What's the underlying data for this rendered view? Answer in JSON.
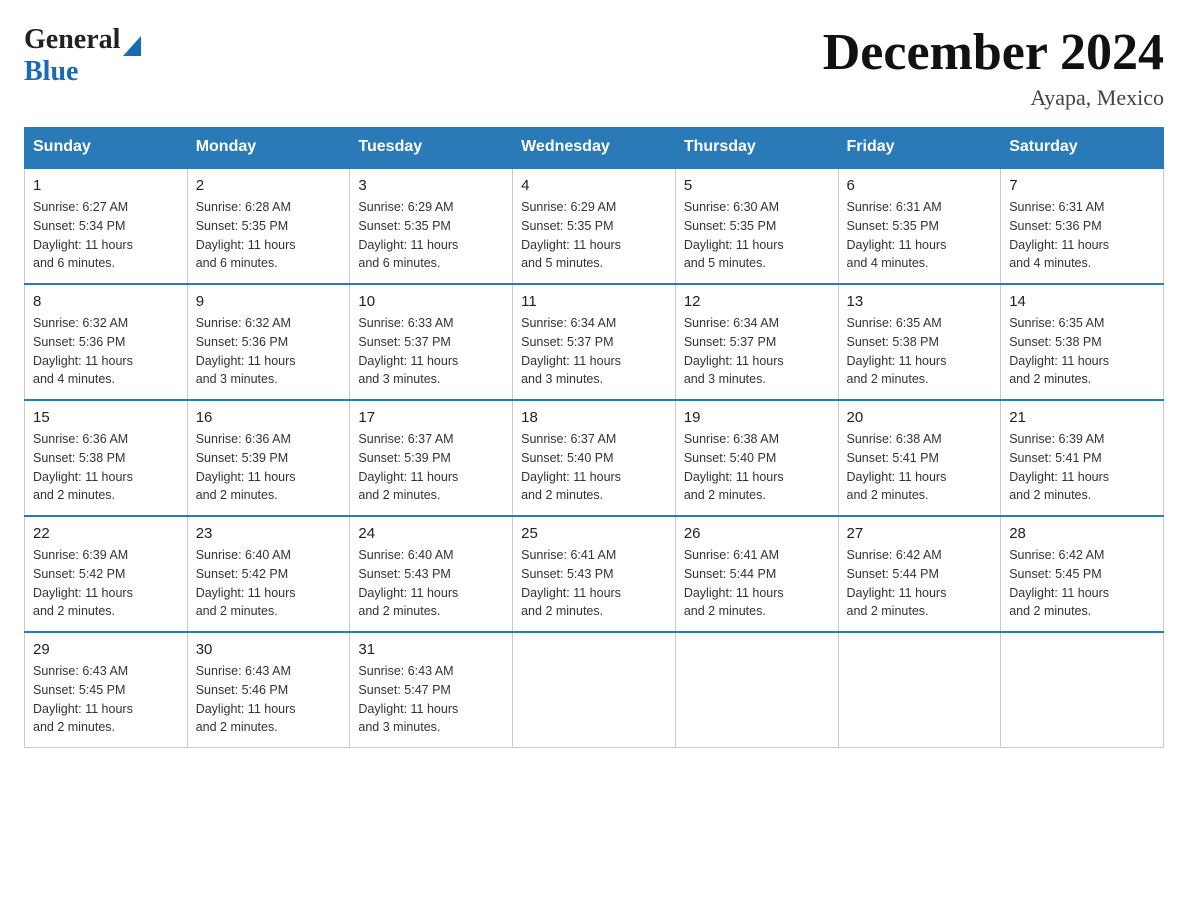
{
  "logo": {
    "text_general": "General",
    "text_blue": "Blue",
    "triangle": "▶"
  },
  "title": "December 2024",
  "subtitle": "Ayapa, Mexico",
  "headers": [
    "Sunday",
    "Monday",
    "Tuesday",
    "Wednesday",
    "Thursday",
    "Friday",
    "Saturday"
  ],
  "weeks": [
    [
      {
        "day": "1",
        "info": "Sunrise: 6:27 AM\nSunset: 5:34 PM\nDaylight: 11 hours\nand 6 minutes."
      },
      {
        "day": "2",
        "info": "Sunrise: 6:28 AM\nSunset: 5:35 PM\nDaylight: 11 hours\nand 6 minutes."
      },
      {
        "day": "3",
        "info": "Sunrise: 6:29 AM\nSunset: 5:35 PM\nDaylight: 11 hours\nand 6 minutes."
      },
      {
        "day": "4",
        "info": "Sunrise: 6:29 AM\nSunset: 5:35 PM\nDaylight: 11 hours\nand 5 minutes."
      },
      {
        "day": "5",
        "info": "Sunrise: 6:30 AM\nSunset: 5:35 PM\nDaylight: 11 hours\nand 5 minutes."
      },
      {
        "day": "6",
        "info": "Sunrise: 6:31 AM\nSunset: 5:35 PM\nDaylight: 11 hours\nand 4 minutes."
      },
      {
        "day": "7",
        "info": "Sunrise: 6:31 AM\nSunset: 5:36 PM\nDaylight: 11 hours\nand 4 minutes."
      }
    ],
    [
      {
        "day": "8",
        "info": "Sunrise: 6:32 AM\nSunset: 5:36 PM\nDaylight: 11 hours\nand 4 minutes."
      },
      {
        "day": "9",
        "info": "Sunrise: 6:32 AM\nSunset: 5:36 PM\nDaylight: 11 hours\nand 3 minutes."
      },
      {
        "day": "10",
        "info": "Sunrise: 6:33 AM\nSunset: 5:37 PM\nDaylight: 11 hours\nand 3 minutes."
      },
      {
        "day": "11",
        "info": "Sunrise: 6:34 AM\nSunset: 5:37 PM\nDaylight: 11 hours\nand 3 minutes."
      },
      {
        "day": "12",
        "info": "Sunrise: 6:34 AM\nSunset: 5:37 PM\nDaylight: 11 hours\nand 3 minutes."
      },
      {
        "day": "13",
        "info": "Sunrise: 6:35 AM\nSunset: 5:38 PM\nDaylight: 11 hours\nand 2 minutes."
      },
      {
        "day": "14",
        "info": "Sunrise: 6:35 AM\nSunset: 5:38 PM\nDaylight: 11 hours\nand 2 minutes."
      }
    ],
    [
      {
        "day": "15",
        "info": "Sunrise: 6:36 AM\nSunset: 5:38 PM\nDaylight: 11 hours\nand 2 minutes."
      },
      {
        "day": "16",
        "info": "Sunrise: 6:36 AM\nSunset: 5:39 PM\nDaylight: 11 hours\nand 2 minutes."
      },
      {
        "day": "17",
        "info": "Sunrise: 6:37 AM\nSunset: 5:39 PM\nDaylight: 11 hours\nand 2 minutes."
      },
      {
        "day": "18",
        "info": "Sunrise: 6:37 AM\nSunset: 5:40 PM\nDaylight: 11 hours\nand 2 minutes."
      },
      {
        "day": "19",
        "info": "Sunrise: 6:38 AM\nSunset: 5:40 PM\nDaylight: 11 hours\nand 2 minutes."
      },
      {
        "day": "20",
        "info": "Sunrise: 6:38 AM\nSunset: 5:41 PM\nDaylight: 11 hours\nand 2 minutes."
      },
      {
        "day": "21",
        "info": "Sunrise: 6:39 AM\nSunset: 5:41 PM\nDaylight: 11 hours\nand 2 minutes."
      }
    ],
    [
      {
        "day": "22",
        "info": "Sunrise: 6:39 AM\nSunset: 5:42 PM\nDaylight: 11 hours\nand 2 minutes."
      },
      {
        "day": "23",
        "info": "Sunrise: 6:40 AM\nSunset: 5:42 PM\nDaylight: 11 hours\nand 2 minutes."
      },
      {
        "day": "24",
        "info": "Sunrise: 6:40 AM\nSunset: 5:43 PM\nDaylight: 11 hours\nand 2 minutes."
      },
      {
        "day": "25",
        "info": "Sunrise: 6:41 AM\nSunset: 5:43 PM\nDaylight: 11 hours\nand 2 minutes."
      },
      {
        "day": "26",
        "info": "Sunrise: 6:41 AM\nSunset: 5:44 PM\nDaylight: 11 hours\nand 2 minutes."
      },
      {
        "day": "27",
        "info": "Sunrise: 6:42 AM\nSunset: 5:44 PM\nDaylight: 11 hours\nand 2 minutes."
      },
      {
        "day": "28",
        "info": "Sunrise: 6:42 AM\nSunset: 5:45 PM\nDaylight: 11 hours\nand 2 minutes."
      }
    ],
    [
      {
        "day": "29",
        "info": "Sunrise: 6:43 AM\nSunset: 5:45 PM\nDaylight: 11 hours\nand 2 minutes."
      },
      {
        "day": "30",
        "info": "Sunrise: 6:43 AM\nSunset: 5:46 PM\nDaylight: 11 hours\nand 2 minutes."
      },
      {
        "day": "31",
        "info": "Sunrise: 6:43 AM\nSunset: 5:47 PM\nDaylight: 11 hours\nand 3 minutes."
      },
      {
        "day": "",
        "info": ""
      },
      {
        "day": "",
        "info": ""
      },
      {
        "day": "",
        "info": ""
      },
      {
        "day": "",
        "info": ""
      }
    ]
  ]
}
